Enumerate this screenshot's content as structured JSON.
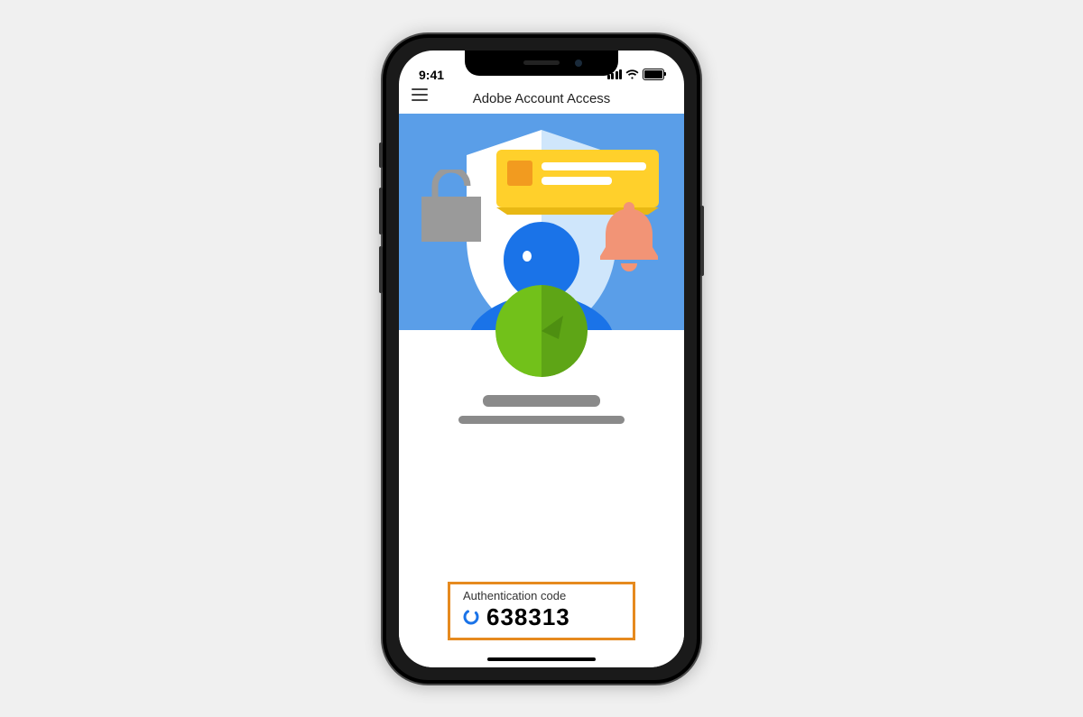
{
  "status": {
    "time": "9:41"
  },
  "header": {
    "title": "Adobe Account Access"
  },
  "auth": {
    "label": "Authentication code",
    "code": "638313"
  },
  "colors": {
    "heroBg": "#5a9ee8",
    "shieldLeft": "#ffffff",
    "shieldRight": "#cfe6fb",
    "head": "#1a73e8",
    "lock": "#9a9a9a",
    "ticket": "#ffd02b",
    "ticketAccent": "#f29b1f",
    "bell": "#f29476",
    "avatarLight": "#72c11a",
    "avatarDark": "#5ea516",
    "highlight": "#e68a1f",
    "spinner": "#1a73e8"
  },
  "icons": {
    "menu": "menu-icon",
    "lock": "lock-icon",
    "bell": "bell-icon",
    "shield": "shield-icon",
    "person": "person-icon",
    "ticket": "ticket-icon",
    "avatar": "avatar-icon",
    "spinner": "spinner-icon"
  }
}
